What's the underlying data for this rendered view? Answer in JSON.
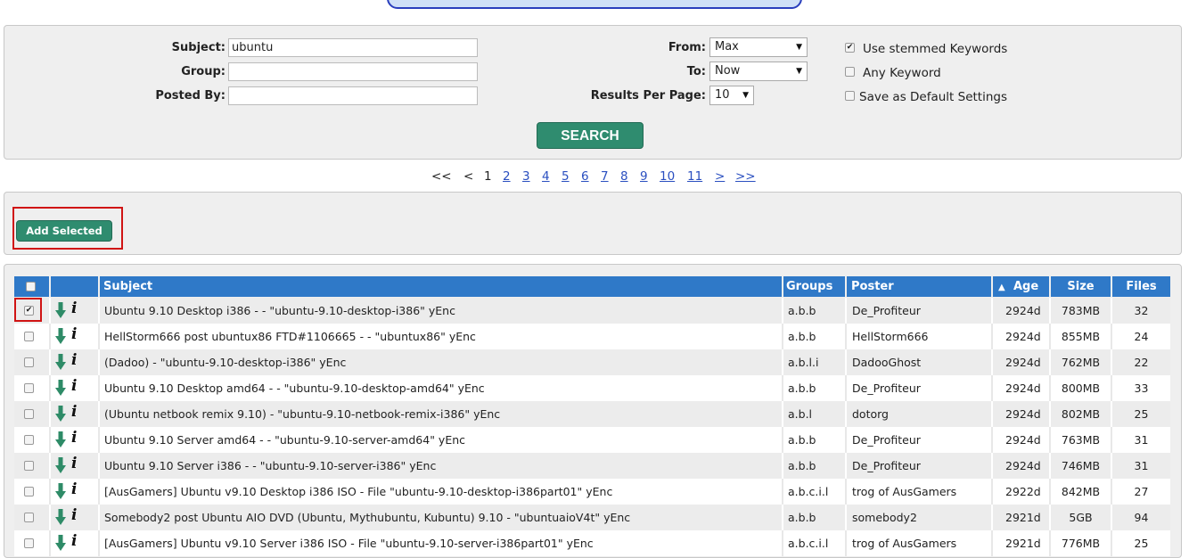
{
  "search": {
    "subject_label": "Subject:",
    "subject_value": "ubuntu",
    "group_label": "Group:",
    "group_value": "",
    "posted_by_label": "Posted By:",
    "posted_by_value": "",
    "from_label": "From:",
    "from_value": "Max",
    "to_label": "To:",
    "to_value": "Now",
    "results_per_page_label": "Results Per Page:",
    "results_per_page_value": "10",
    "use_stemmed_label": "Use stemmed Keywords",
    "use_stemmed_checked": true,
    "any_keyword_label": "Any Keyword",
    "any_keyword_checked": false,
    "save_default_label": "Save as Default Settings",
    "save_default_checked": false,
    "search_button": "SEARCH"
  },
  "pagination": {
    "first": "<<",
    "prev": "<",
    "current": "1",
    "pages": [
      "2",
      "3",
      "4",
      "5",
      "6",
      "7",
      "8",
      "9",
      "10",
      "11"
    ],
    "next": ">",
    "last": ">>"
  },
  "actions": {
    "add_selected": "Add Selected"
  },
  "table": {
    "headers": {
      "subject": "Subject",
      "groups": "Groups",
      "poster": "Poster",
      "age": "Age",
      "size": "Size",
      "files": "Files"
    },
    "sort_indicator": "▲",
    "rows": [
      {
        "checked": true,
        "subject": "Ubuntu 9.10 Desktop i386 - - \"ubuntu-9.10-desktop-i386\" yEnc",
        "groups": "a.b.b",
        "poster": "De_Profiteur",
        "age": "2924d",
        "size": "783MB",
        "files": "32"
      },
      {
        "checked": false,
        "subject": "HellStorm666 post ubuntux86 FTD#1106665 - - \"ubuntux86\" yEnc",
        "groups": "a.b.b",
        "poster": "HellStorm666",
        "age": "2924d",
        "size": "855MB",
        "files": "24"
      },
      {
        "checked": false,
        "subject": "(Dadoo) - \"ubuntu-9.10-desktop-i386\" yEnc",
        "groups": "a.b.l.i",
        "poster": "DadooGhost",
        "age": "2924d",
        "size": "762MB",
        "files": "22"
      },
      {
        "checked": false,
        "subject": "Ubuntu 9.10 Desktop amd64 - - \"ubuntu-9.10-desktop-amd64\" yEnc",
        "groups": "a.b.b",
        "poster": "De_Profiteur",
        "age": "2924d",
        "size": "800MB",
        "files": "33"
      },
      {
        "checked": false,
        "subject": "(Ubuntu netbook remix 9.10) - \"ubuntu-9.10-netbook-remix-i386\" yEnc",
        "groups": "a.b.l",
        "poster": "dotorg",
        "age": "2924d",
        "size": "802MB",
        "files": "25"
      },
      {
        "checked": false,
        "subject": "Ubuntu 9.10 Server amd64 - - \"ubuntu-9.10-server-amd64\" yEnc",
        "groups": "a.b.b",
        "poster": "De_Profiteur",
        "age": "2924d",
        "size": "763MB",
        "files": "31"
      },
      {
        "checked": false,
        "subject": "Ubuntu 9.10 Server i386 - - \"ubuntu-9.10-server-i386\" yEnc",
        "groups": "a.b.b",
        "poster": "De_Profiteur",
        "age": "2924d",
        "size": "746MB",
        "files": "31"
      },
      {
        "checked": false,
        "subject": "[AusGamers] Ubuntu v9.10 Desktop i386 ISO - File \"ubuntu-9.10-desktop-i386part01\" yEnc",
        "groups": "a.b.c.i.l",
        "poster": "trog of AusGamers",
        "age": "2922d",
        "size": "842MB",
        "files": "27"
      },
      {
        "checked": false,
        "subject": "Somebody2 post Ubuntu AIO DVD (Ubuntu, Mythubuntu, Kubuntu) 9.10 - \"ubuntuaioV4t\" yEnc",
        "groups": "a.b.b",
        "poster": "somebody2",
        "age": "2921d",
        "size": "5GB",
        "files": "94"
      },
      {
        "checked": false,
        "subject": "[AusGamers] Ubuntu v9.10 Server i386 ISO - File \"ubuntu-9.10-server-i386part01\" yEnc",
        "groups": "a.b.c.i.l",
        "poster": "trog of AusGamers",
        "age": "2921d",
        "size": "776MB",
        "files": "25"
      }
    ]
  },
  "colors": {
    "header_blue": "#2f79c8",
    "button_green": "#2f8c6f",
    "download_arrow": "#2e8b67",
    "highlight_red": "#d01414",
    "link_blue": "#2a4fc0"
  }
}
